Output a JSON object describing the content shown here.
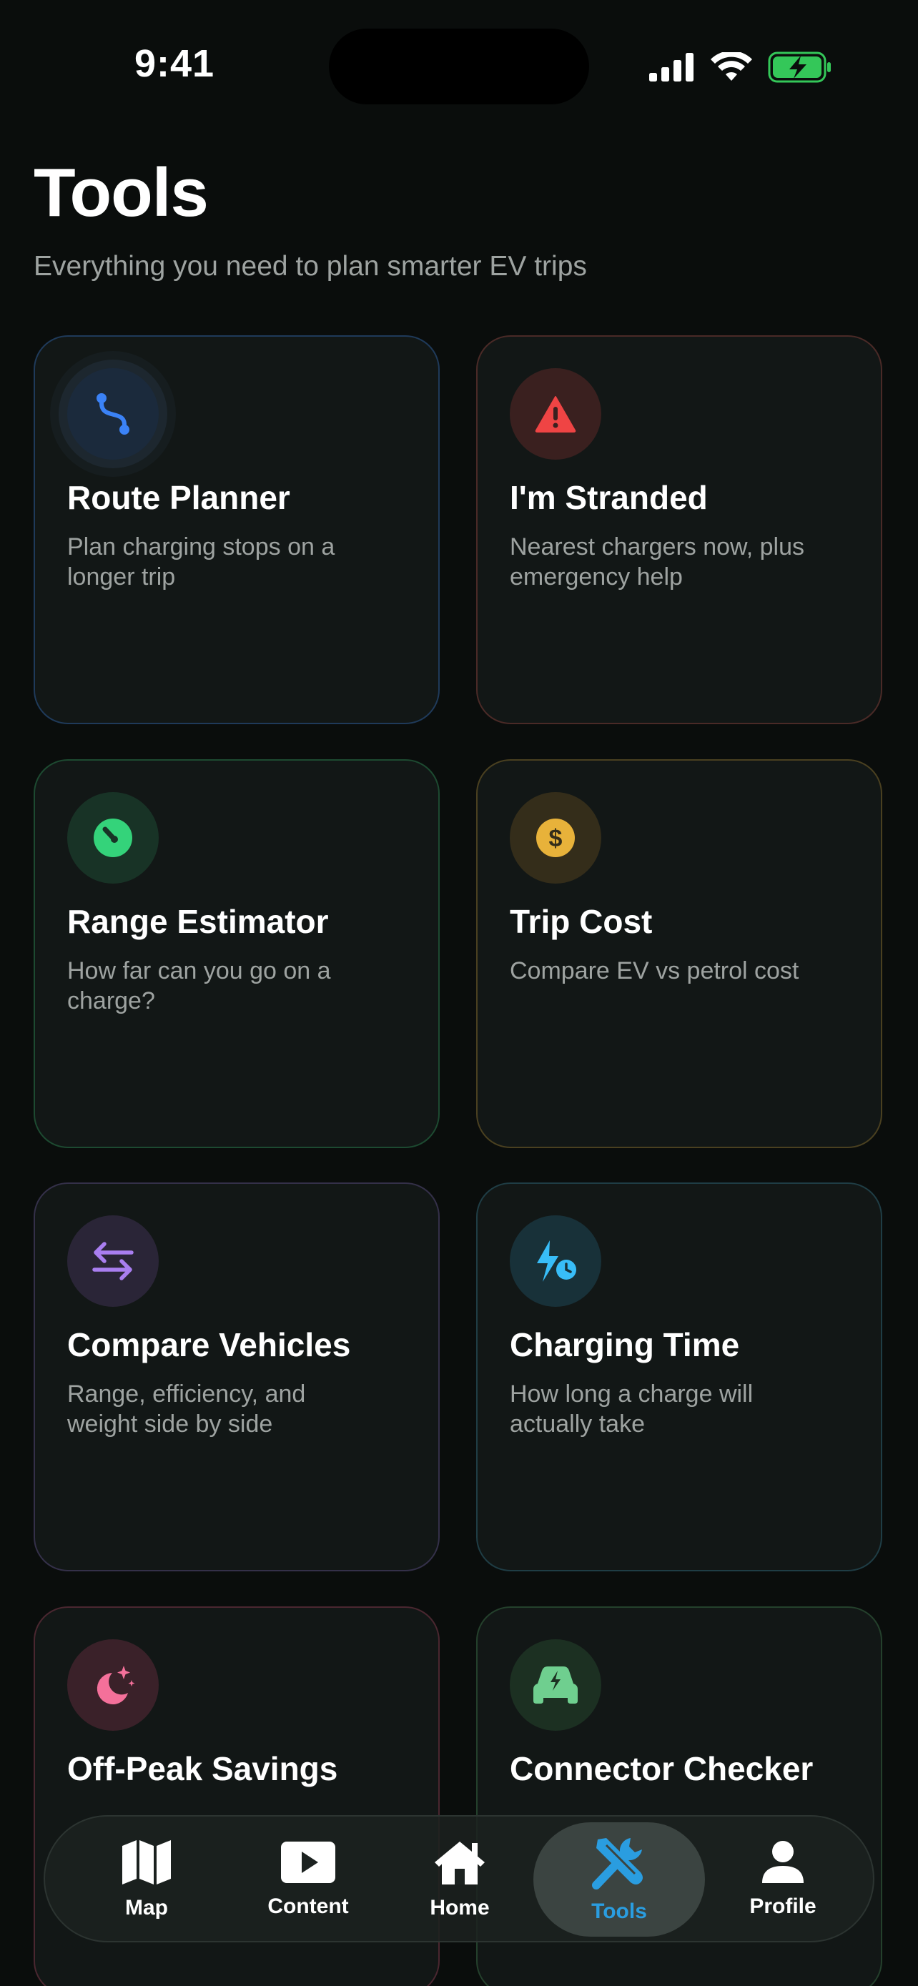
{
  "status_bar": {
    "time": "9:41"
  },
  "header": {
    "title": "Tools",
    "subtitle": "Everything you need to plan smarter EV trips"
  },
  "tools": [
    {
      "title": "Route Planner",
      "description": "Plan charging stops on a longer trip",
      "icon": "route-icon",
      "accent": "#3b82f6"
    },
    {
      "title": "I'm Stranded",
      "description": "Nearest chargers now, plus emergency help",
      "icon": "warning-icon",
      "accent": "#ef4444"
    },
    {
      "title": "Range Estimator",
      "description": "How far can you go on a charge?",
      "icon": "gauge-icon",
      "accent": "#34d37a"
    },
    {
      "title": "Trip Cost",
      "description": "Compare EV vs petrol cost",
      "icon": "dollar-icon",
      "accent": "#e8b23a"
    },
    {
      "title": "Compare Vehicles",
      "description": "Range, efficiency, and weight side by side",
      "icon": "swap-arrows-icon",
      "accent": "#a97ef0"
    },
    {
      "title": "Charging Time",
      "description": "How long a charge will actually take",
      "icon": "charge-clock-icon",
      "accent": "#38bdf8"
    },
    {
      "title": "Off-Peak Savings",
      "description": "",
      "icon": "moon-stars-icon",
      "accent": "#f4709a"
    },
    {
      "title": "Connector Checker",
      "description": "",
      "icon": "car-charge-icon",
      "accent": "#6fcf8f"
    }
  ],
  "tab_bar": {
    "tabs": [
      {
        "label": "Map",
        "icon": "map-icon"
      },
      {
        "label": "Content",
        "icon": "play-icon"
      },
      {
        "label": "Home",
        "icon": "home-icon"
      },
      {
        "label": "Tools",
        "icon": "tools-icon"
      },
      {
        "label": "Profile",
        "icon": "person-icon"
      }
    ],
    "active": "Tools",
    "active_color": "#2a9de0"
  },
  "colors": {
    "background": "#0a0d0c",
    "card": "#121716",
    "battery": "#34c759"
  }
}
